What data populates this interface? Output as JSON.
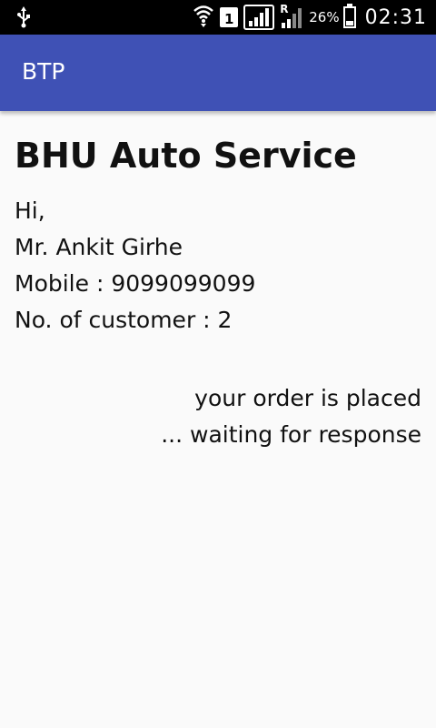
{
  "status_bar": {
    "sim_label": "1",
    "roaming": "R",
    "battery_percent": "26%",
    "battery_level": 0.26,
    "time": "02:31",
    "icons": [
      "usb-icon",
      "wifi-icon",
      "sim-icon",
      "signal-icon",
      "roaming-signal-icon",
      "battery-icon"
    ]
  },
  "app_bar": {
    "title": "BTP",
    "color": "#3f51b5"
  },
  "main": {
    "heading": "BHU Auto Service",
    "greeting": "Hi,",
    "name": "Mr. Ankit Girhe",
    "mobile": "Mobile : 9099099099",
    "customers": "No. of customer : 2",
    "status_line1": "your order is placed",
    "status_line2": "... waiting for response"
  }
}
